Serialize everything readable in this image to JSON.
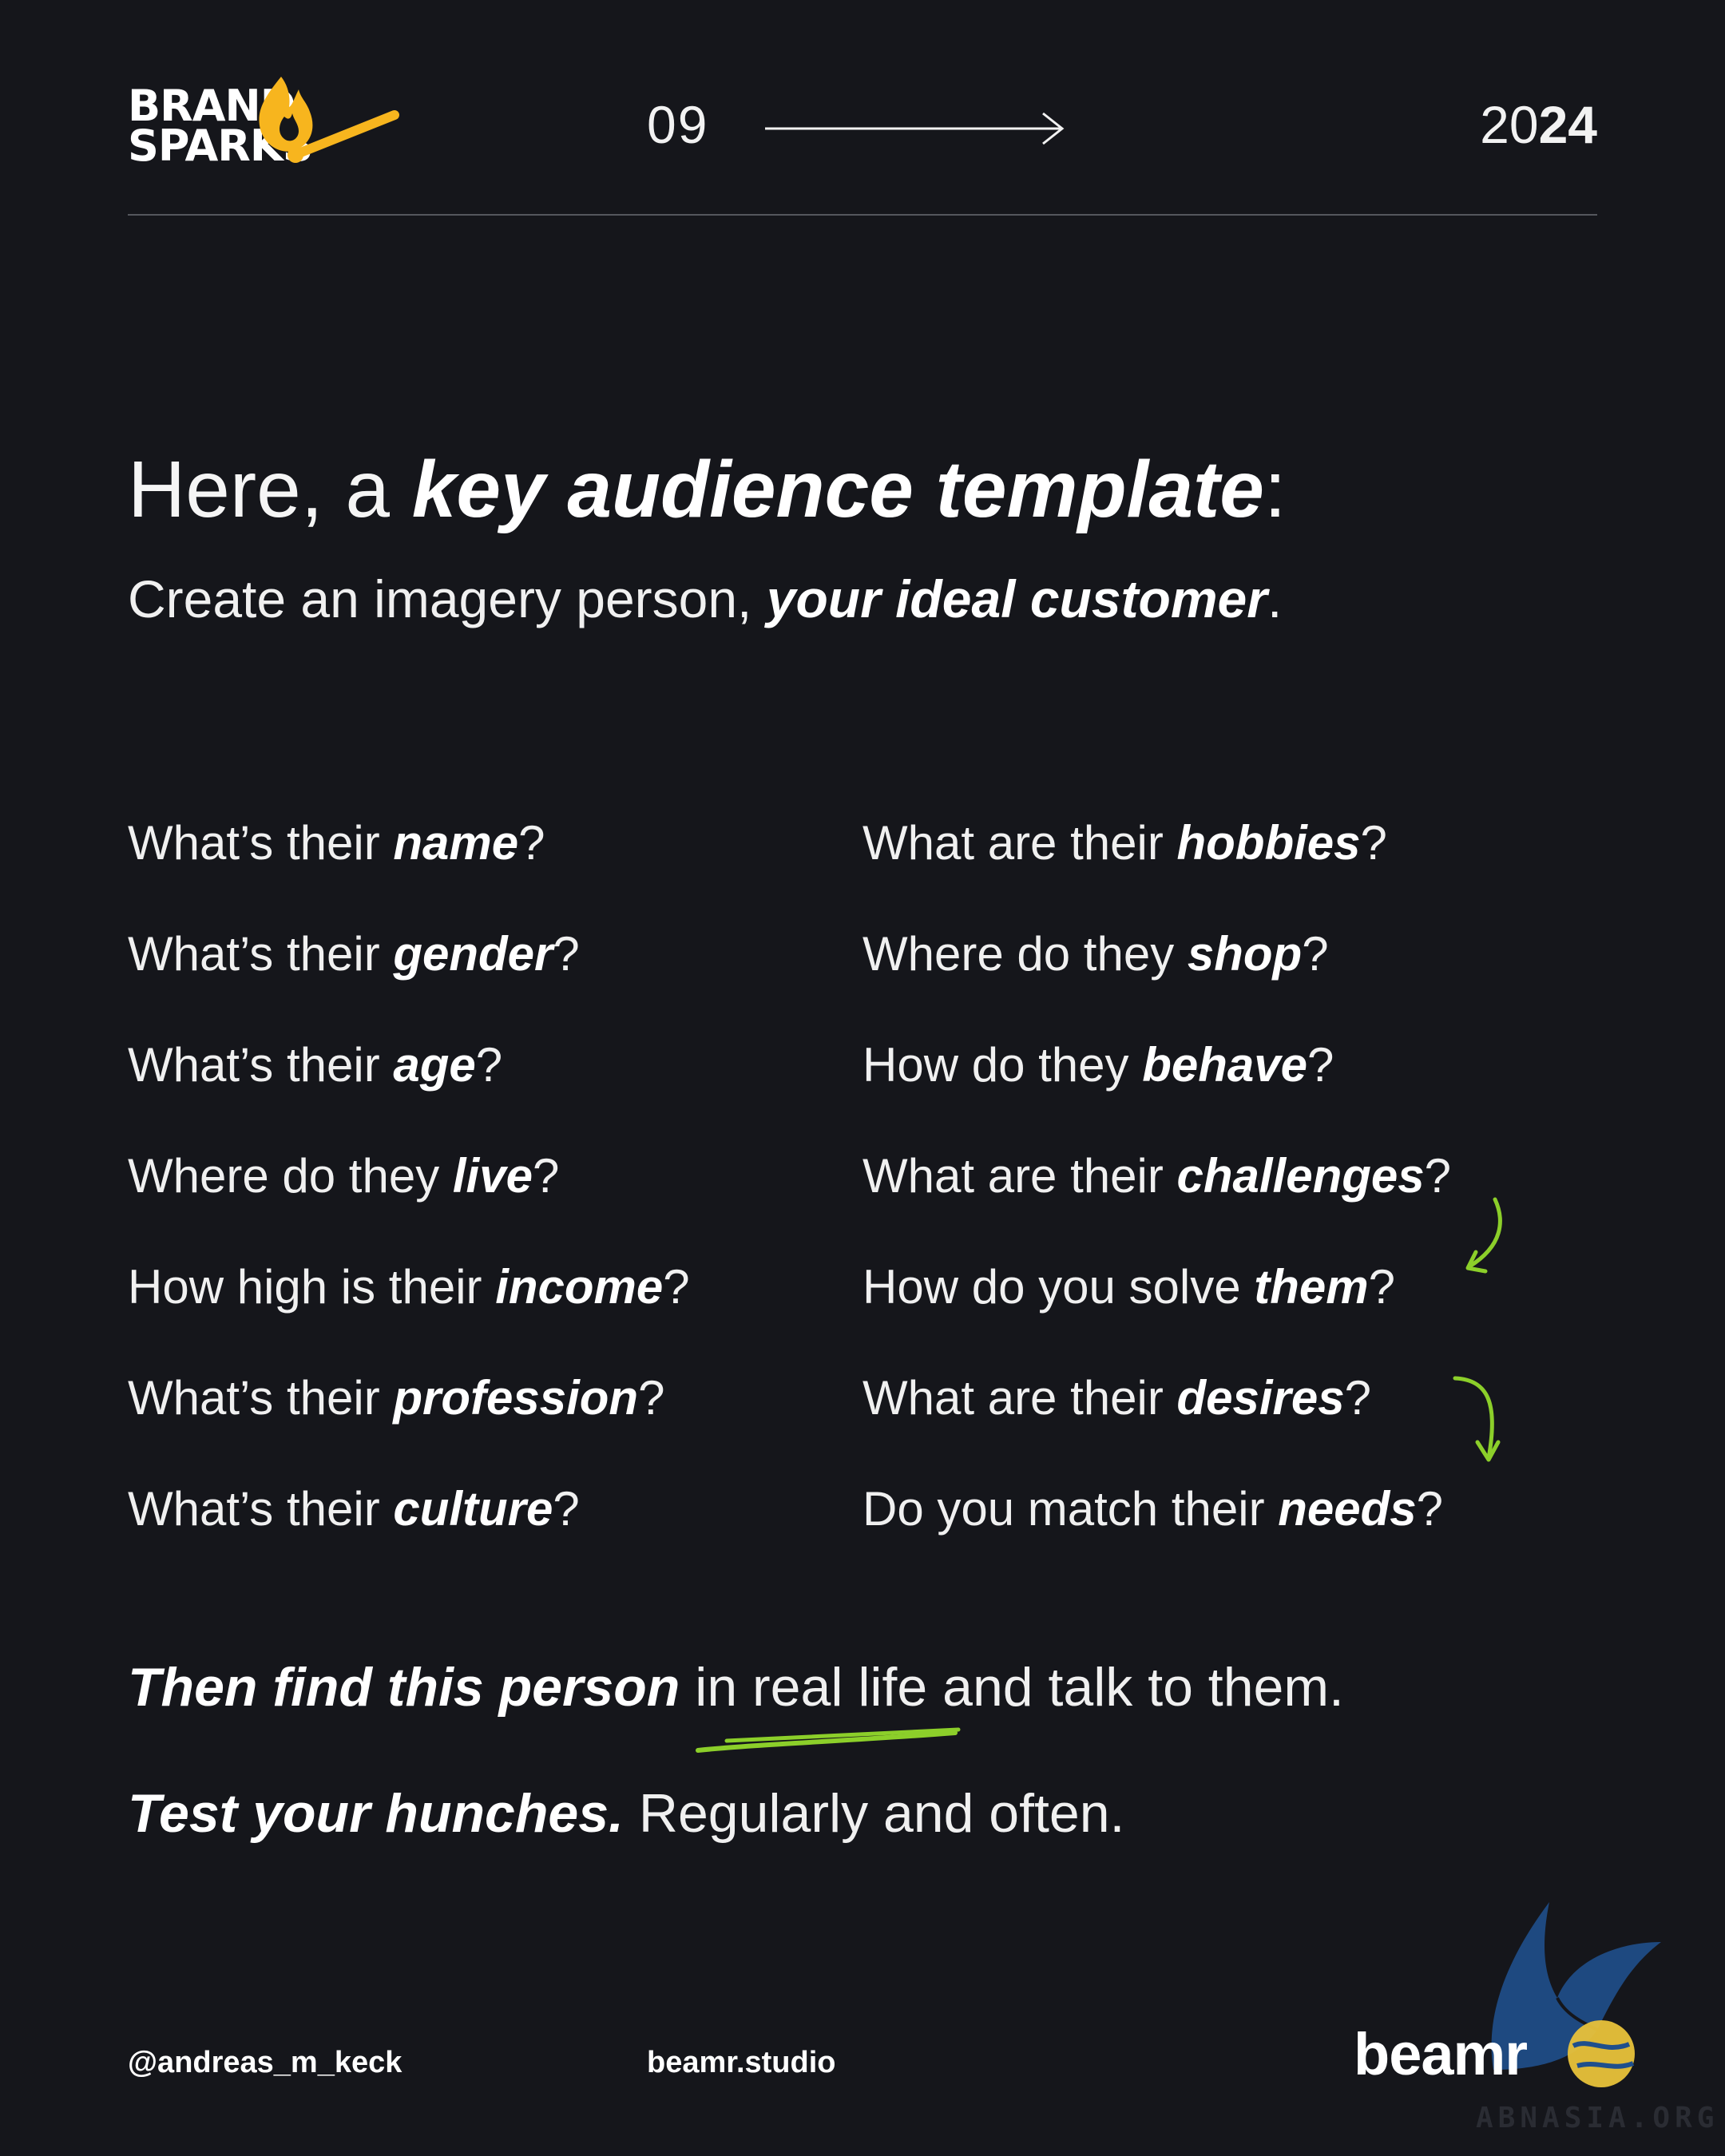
{
  "header": {
    "logo": {
      "line1": "BRAND",
      "line2": "SPARKS"
    },
    "page_number": "09",
    "year_light": "20",
    "year_bold": "24"
  },
  "title": {
    "prefix": "Here, a ",
    "emphasis": "key audience template",
    "suffix": ":"
  },
  "subtitle": {
    "prefix": "Create an imagery person, ",
    "emphasis": "your ideal customer",
    "suffix": "."
  },
  "questions_left": [
    {
      "prefix": "What’s their ",
      "emphasis": "name",
      "suffix": "?"
    },
    {
      "prefix": "What’s their ",
      "emphasis": "gender",
      "suffix": "?"
    },
    {
      "prefix": "What’s their ",
      "emphasis": "age",
      "suffix": "?"
    },
    {
      "prefix": "Where do they ",
      "emphasis": "live",
      "suffix": "?"
    },
    {
      "prefix": "How high is their ",
      "emphasis": "income",
      "suffix": "?"
    },
    {
      "prefix": "What’s their ",
      "emphasis": "profession",
      "suffix": "?"
    },
    {
      "prefix": "What’s their ",
      "emphasis": "culture",
      "suffix": "?"
    }
  ],
  "questions_right": [
    {
      "prefix": "What are their ",
      "emphasis": "hobbies",
      "suffix": "?"
    },
    {
      "prefix": "Where do they ",
      "emphasis": "shop",
      "suffix": "?"
    },
    {
      "prefix": "How do they ",
      "emphasis": "behave",
      "suffix": "?"
    },
    {
      "prefix": "What are their ",
      "emphasis": "challenges",
      "suffix": "?"
    },
    {
      "prefix": "How do you solve ",
      "emphasis": "them",
      "suffix": "?"
    },
    {
      "prefix": "What are their ",
      "emphasis": "desires",
      "suffix": "?"
    },
    {
      "prefix": "Do you match their ",
      "emphasis": "needs",
      "suffix": "?"
    }
  ],
  "closing": {
    "line1": {
      "emphasis": "Then find this person",
      "underlined": " in real life",
      "rest": " and talk to them."
    },
    "line2": {
      "emphasis": "Test your hunches.",
      "rest": " Regularly and often."
    }
  },
  "footer": {
    "handle": "@andreas_m_keck",
    "website": "beamr.studio",
    "brand": "beamr"
  },
  "watermark": {
    "text": "ABNASIA.ORG"
  },
  "colors": {
    "background": "#15161b",
    "text": "#f2f2f2",
    "accent_green": "#8ccf2a",
    "logo_yellow": "#f7b51e",
    "divider": "#55575d"
  },
  "icons": {
    "logo": "flame-match-icon",
    "header_arrow": "arrow-right-icon",
    "annotation_1": "curved-arrow-down-left-icon",
    "annotation_2": "curved-arrow-down-icon",
    "underline": "hand-drawn-underline-icon",
    "watermark_bird": "bird-globe-logo-icon"
  }
}
